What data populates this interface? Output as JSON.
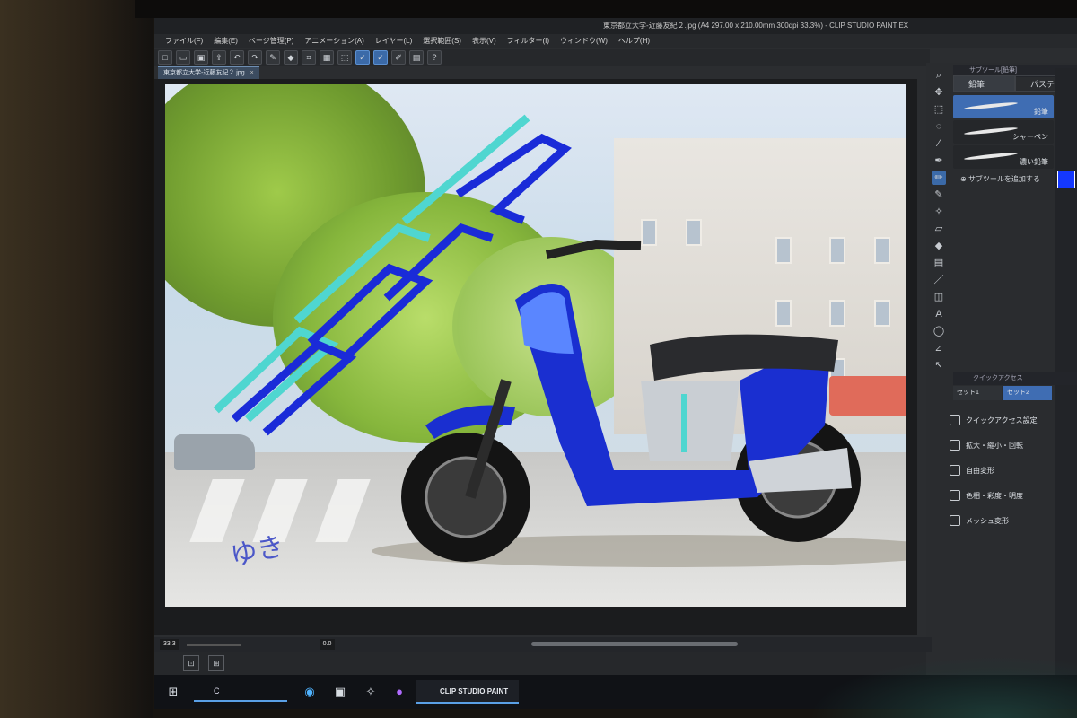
{
  "app": {
    "window_title": "東京都立大学-近藤友紀２.jpg (A4 297.00 x 210.00mm 300dpi 33.3%) - CLIP STUDIO PAINT EX",
    "document_tab": "東京都立大学-近藤友紀２.jpg",
    "tab_close": "×"
  },
  "menu": [
    "ファイル(F)",
    "編集(E)",
    "ページ管理(P)",
    "アニメーション(A)",
    "レイヤー(L)",
    "選択範囲(S)",
    "表示(V)",
    "フィルター(I)",
    "ウィンドウ(W)",
    "ヘルプ(H)"
  ],
  "command_bar_icons": [
    "new-icon",
    "open-icon",
    "save-icon",
    "export-icon",
    "undo-icon",
    "redo-icon",
    "brush-icon",
    "fill-icon",
    "crop-icon",
    "grid-icon",
    "transform-icon",
    "check-icon",
    "pen-icon",
    "edit-icon",
    "panel-icon",
    "help-icon"
  ],
  "artwork": {
    "logo_text": "PEdS",
    "signature": "ゆき"
  },
  "tools": [
    "zoom-icon",
    "move-icon",
    "select-icon",
    "lasso-icon",
    "eyedropper-icon",
    "pen-icon",
    "pencil-icon",
    "brush-icon",
    "airbrush-icon",
    "eraser-icon",
    "fill-icon",
    "gradient-icon",
    "figure-icon",
    "frame-icon",
    "text-icon",
    "balloon-icon",
    "ruler-icon",
    "line-icon"
  ],
  "subtool": {
    "header": "サブツール[鉛筆]",
    "tabs": [
      "鉛筆",
      "パステル"
    ],
    "brushes": [
      {
        "name": "鉛筆",
        "selected": true
      },
      {
        "name": "シャーペン",
        "selected": false
      },
      {
        "name": "濃い鉛筆",
        "selected": false
      }
    ],
    "add_label": "サブツールを追加する"
  },
  "quick_access": {
    "header": "クイックアクセス",
    "sets": [
      "セット1",
      "セット2"
    ],
    "items": [
      "クイックアクセス設定",
      "拡大・縮小・回転",
      "自由変形",
      "色相・彩度・明度",
      "メッシュ変形"
    ]
  },
  "status": {
    "zoom": "33.3",
    "rotation": "0.0"
  },
  "taskbar": {
    "search_text": "C",
    "active_app": "CLIP STUDIO PAINT"
  },
  "colors": {
    "main_color": "#1438ff",
    "accent": "#3f6db3",
    "scooter_blue": "#1a2fd0",
    "logo_teal": "#4fd6d0",
    "logo_blue": "#1a2bd8"
  }
}
